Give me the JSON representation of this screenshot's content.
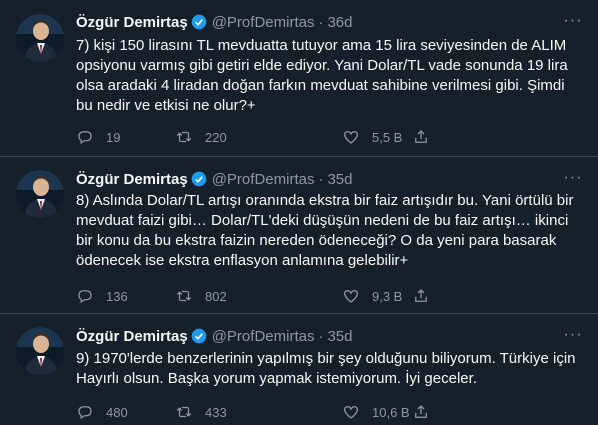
{
  "tweets": [
    {
      "name": "Özgür Demirtaş",
      "handle": "@ProfDemirtas",
      "dot": "·",
      "time": "36d",
      "text": "7) kişi 150 lirasını TL mevduatta tutuyor ama 15 lira seviyesinden de ALIM\nopsiyonu varmış gibi getiri elde ediyor. Yani Dolar/TL vade sonunda 19 lira\nolsa aradaki 4 liradan doğan farkın mevduat sahibine verilmesi gibi. Şimdi\nbu nedir ve etkisi ne olur?+",
      "replies": "19",
      "retweets": "220",
      "likes": "5,5 B"
    },
    {
      "name": "Özgür Demirtaş",
      "handle": "@ProfDemirtas",
      "dot": "·",
      "time": "35d",
      "text": "8) Aslında Dolar/TL artışı oranında ekstra bir faiz artışıdır bu. Yani örtülü bir\nmevduat faizi gibi… Dolar/TL'deki düşüşün nedeni de bu faiz artışı… ikinci\nbir konu da bu ekstra faizin nereden ödeneceği? O da yeni para basarak\nödenecek ise ekstra enflasyon anlamına gelebilir+",
      "replies": "136",
      "retweets": "802",
      "likes": "9,3 B"
    },
    {
      "name": "Özgür Demirtaş",
      "handle": "@ProfDemirtas",
      "dot": "·",
      "time": "35d",
      "text": "9) 1970'lerde benzerlerinin yapılmış bir şey olduğunu biliyorum. Türkiye için\nHayırlı olsun. Başka yorum yapmak istemiyorum. İyi geceler.",
      "replies": "480",
      "retweets": "433",
      "likes": "10,6 B"
    }
  ],
  "more_symbol": "···",
  "colors": {
    "background": "#15202b",
    "text": "#f7f9f9",
    "muted": "#8b98a5",
    "verified": "#1d9bf0",
    "separator": "#38444d"
  }
}
